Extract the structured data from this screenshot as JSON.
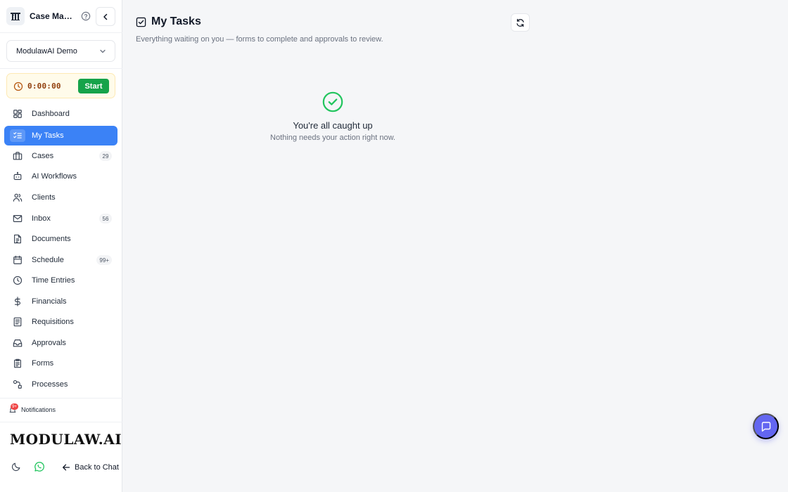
{
  "app": {
    "title": "Case Management"
  },
  "workspace": {
    "selected": "ModulawAI Demo"
  },
  "timer": {
    "time": "0:00:00",
    "start_label": "Start"
  },
  "nav": {
    "items": [
      {
        "label": "Dashboard",
        "icon": "dashboard-icon"
      },
      {
        "label": "My Tasks",
        "icon": "tasks-icon",
        "active": true
      },
      {
        "label": "Cases",
        "icon": "briefcase-icon",
        "badge": "29"
      },
      {
        "label": "AI Workflows",
        "icon": "bot-icon"
      },
      {
        "label": "Clients",
        "icon": "users-icon"
      },
      {
        "label": "Inbox",
        "icon": "mail-icon",
        "badge": "56"
      },
      {
        "label": "Documents",
        "icon": "document-icon"
      },
      {
        "label": "Schedule",
        "icon": "calendar-icon",
        "badge": "99+"
      },
      {
        "label": "Time Entries",
        "icon": "clock-icon"
      },
      {
        "label": "Financials",
        "icon": "dollar-icon"
      },
      {
        "label": "Requisitions",
        "icon": "receipt-icon"
      },
      {
        "label": "Approvals",
        "icon": "inbox-tray-icon"
      },
      {
        "label": "Forms",
        "icon": "clipboard-icon"
      },
      {
        "label": "Processes",
        "icon": "workflow-icon"
      }
    ]
  },
  "notifications": {
    "label": "Notifications",
    "badge": "9+"
  },
  "brand": {
    "text": "MODULAW.AI"
  },
  "footer": {
    "back_label": "Back to Chat"
  },
  "page": {
    "title": "My Tasks",
    "subtitle": "Everything waiting on you — forms to complete and approvals to review."
  },
  "empty_state": {
    "title": "You're all caught up",
    "subtitle": "Nothing needs your action right now."
  },
  "colors": {
    "accent": "#3b82f6",
    "success": "#22c55e",
    "start_button": "#16a34a",
    "chat_fab": "#6366f1",
    "badge_red": "#ef4444"
  }
}
